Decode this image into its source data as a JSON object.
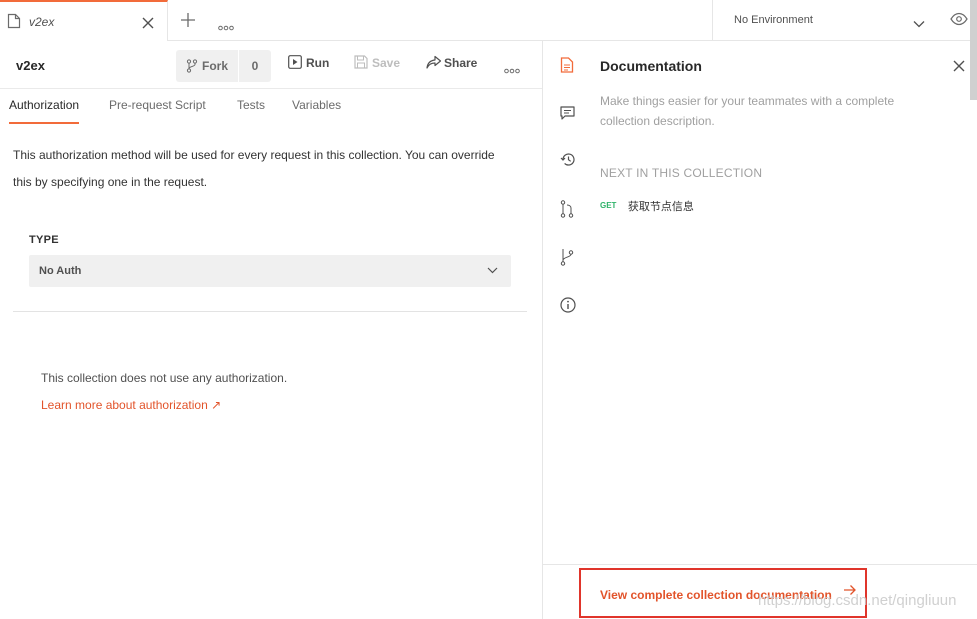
{
  "tabbar": {
    "tab_title": "v2ex",
    "environment": "No Environment"
  },
  "collection": {
    "name": "v2ex",
    "fork_label": "Fork",
    "fork_count": "0",
    "run_label": "Run",
    "save_label": "Save",
    "share_label": "Share"
  },
  "subtabs": [
    "Authorization",
    "Pre-request Script",
    "Tests",
    "Variables"
  ],
  "auth": {
    "description": "This authorization method will be used for every request in this collection. You can override this by specifying one in the request.",
    "type_label": "TYPE",
    "type_value": "No Auth",
    "no_auth_text": "This collection does not use any authorization.",
    "learn_more": "Learn more about authorization ↗"
  },
  "docs": {
    "title": "Documentation",
    "description": "Make things easier for your teammates with a complete collection description.",
    "next_label": "NEXT IN THIS COLLECTION",
    "next_request": {
      "method": "GET",
      "name": "获取节点信息"
    },
    "view_complete": "View complete collection documentation"
  },
  "watermark": "https://blog.csdn.net/qingliuun",
  "colors": {
    "accent": "#f26b3a",
    "link": "#e2542b",
    "get_method": "#2fb36a",
    "highlight_box": "#e0352b"
  }
}
